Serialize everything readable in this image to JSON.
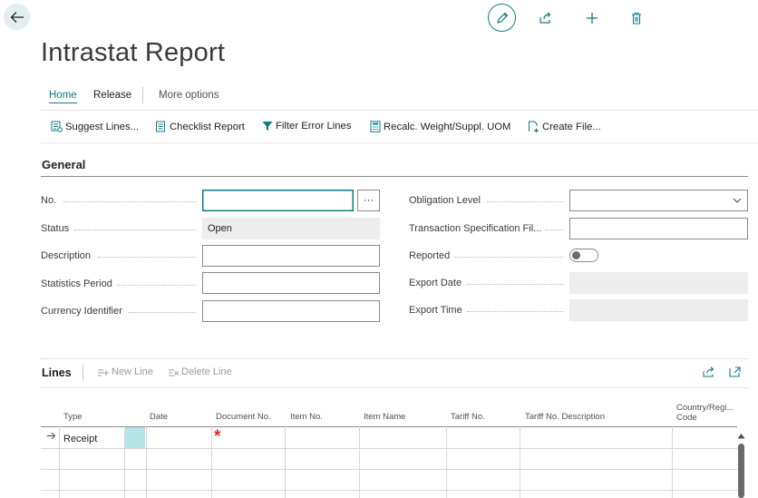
{
  "page": {
    "title": "Intrastat Report"
  },
  "header_actions": {
    "edit": "pencil-icon",
    "share": "share-icon",
    "add": "plus-icon",
    "delete": "trash-icon"
  },
  "menu": {
    "home": "Home",
    "release": "Release",
    "more": "More options"
  },
  "actions": {
    "suggest_lines": "Suggest Lines...",
    "checklist_report": "Checklist Report",
    "filter_error_lines": "Filter Error Lines",
    "recalc": "Recalc. Weight/Suppl. UOM",
    "create_file": "Create File..."
  },
  "general": {
    "heading": "General",
    "left": {
      "no_label": "No.",
      "no_value": "",
      "assist_label": "···",
      "status_label": "Status",
      "status_value": "Open",
      "description_label": "Description",
      "description_value": "",
      "stat_period_label": "Statistics Period",
      "stat_period_value": "",
      "currency_label": "Currency Identifier",
      "currency_value": ""
    },
    "right": {
      "obligation_label": "Obligation Level",
      "obligation_value": "",
      "trans_spec_label": "Transaction Specification Fil...",
      "trans_spec_value": "",
      "reported_label": "Reported",
      "reported_value": false,
      "export_date_label": "Export Date",
      "export_date_value": "",
      "export_time_label": "Export Time",
      "export_time_value": ""
    }
  },
  "lines": {
    "heading": "Lines",
    "new_line": "New Line",
    "delete_line": "Delete Line",
    "columns": {
      "type": "Type",
      "date": "Date",
      "document_no": "Document No.",
      "item_no": "Item No.",
      "item_name": "Item Name",
      "tariff_no": "Tariff No.",
      "tariff_desc": "Tariff No. Description",
      "country_1": "Country/Regi...",
      "country_2": "Code"
    },
    "rows": [
      {
        "type": "Receipt",
        "required_marker": "*"
      }
    ]
  },
  "colors": {
    "accent": "#0e7c86",
    "required": "#d92c2c",
    "selected_cell": "#b4e4e8"
  }
}
